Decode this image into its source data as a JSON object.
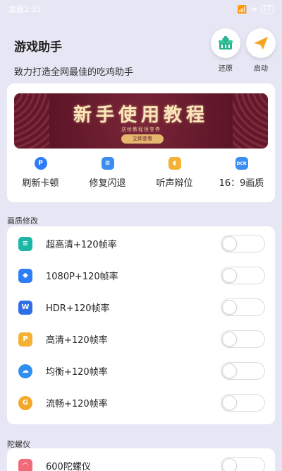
{
  "status_bar": {
    "time": "凌晨2:31",
    "signal": "📶",
    "wifi": "≋",
    "battery": "63"
  },
  "header": {
    "title": "游戏助手",
    "subtitle": "致力打造全网最佳的吃鸡助手"
  },
  "actions": {
    "restore_label": "还原",
    "launch_label": "启动"
  },
  "banner": {
    "title": "新手使用教程",
    "subtitle": "送给教程很变券",
    "button_label": "立即查看"
  },
  "quick_actions": [
    {
      "label": "刷新卡顿",
      "icon": "refresh-icon",
      "color": "#2f7df6",
      "glyph": "P"
    },
    {
      "label": "修复闪退",
      "icon": "repair-icon",
      "color": "#3a8cf0",
      "glyph": "≡"
    },
    {
      "label": "听声辩位",
      "icon": "sound-icon",
      "color": "#f3b235",
      "glyph": "◖"
    },
    {
      "label": "16：9画质",
      "icon": "ratio-icon",
      "color": "#3b8ff1",
      "glyph": "DCR"
    }
  ],
  "quality_section": {
    "title": "画质修改",
    "items": [
      {
        "label": "超高清+120帧率",
        "icon": "ultra-hd-icon",
        "color": "#1ab6a6",
        "glyph": "≡",
        "enabled": false
      },
      {
        "label": "1080P+120帧率",
        "icon": "1080p-icon",
        "color": "#2f7df6",
        "glyph": "◆",
        "enabled": false
      },
      {
        "label": "HDR+120帧率",
        "icon": "hdr-icon",
        "color": "#2f6fe6",
        "glyph": "W",
        "enabled": false
      },
      {
        "label": "高清+120帧率",
        "icon": "hd-icon",
        "color": "#f3b235",
        "glyph": "P",
        "enabled": false
      },
      {
        "label": "均衡+120帧率",
        "icon": "balanced-icon",
        "color": "#2f8ff1",
        "glyph": "☁",
        "enabled": false
      },
      {
        "label": "流畅+120帧率",
        "icon": "smooth-icon",
        "color": "#f3a82a",
        "glyph": "G",
        "enabled": false
      }
    ]
  },
  "gyro_section": {
    "title": "陀螺仪",
    "items": [
      {
        "label": "600陀螺仪",
        "icon": "gyro-icon",
        "color": "#f06a7a",
        "glyph": "◠",
        "enabled": false
      }
    ]
  }
}
